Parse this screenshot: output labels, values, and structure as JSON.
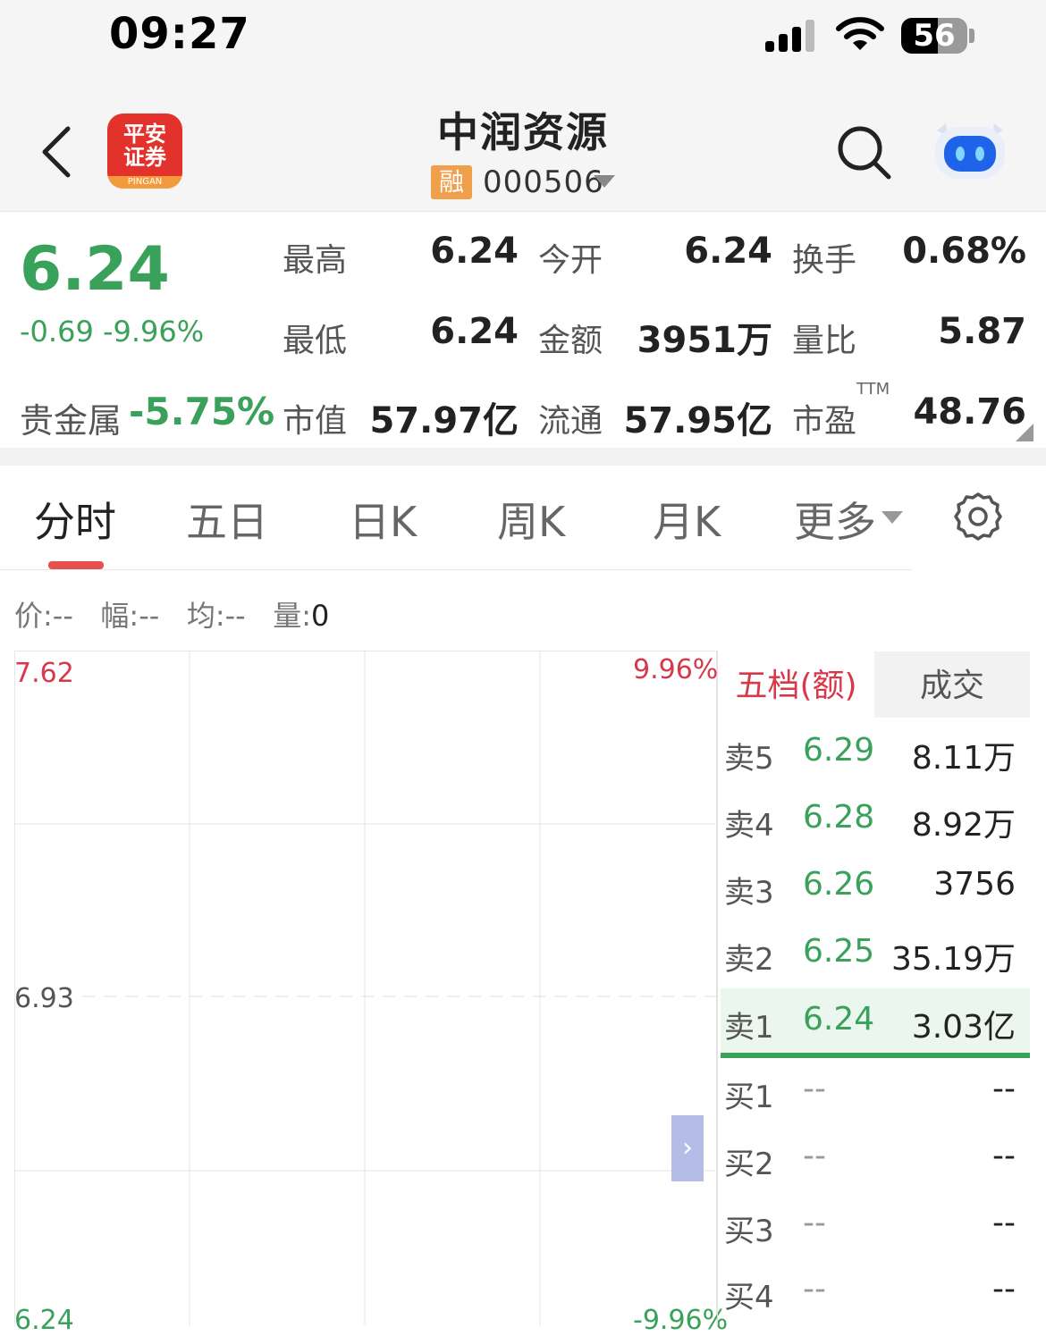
{
  "status_bar": {
    "time": "09:27",
    "battery": "56",
    "battery_level": 0.56
  },
  "header": {
    "back_icon": "chevron-left-icon",
    "logo_line1": "平安",
    "logo_line2": "证券",
    "logo_small": "PINGAN",
    "stock_name": "中润资源",
    "margin_badge": "融",
    "stock_code": "000506",
    "search_icon": "search-icon",
    "assistant_icon": "robot-icon"
  },
  "quote": {
    "price": "6.24",
    "change": "-0.69 -9.96%",
    "sector_label": "贵金属",
    "sector_change": "-5.75%",
    "stats": [
      {
        "label": "最高",
        "value": "6.24",
        "green": true
      },
      {
        "label": "今开",
        "value": "6.24",
        "green": true
      },
      {
        "label": "换手",
        "value": "0.68%",
        "green": false
      },
      {
        "label": "最低",
        "value": "6.24",
        "green": true
      },
      {
        "label": "金额",
        "value": "3951万",
        "green": false
      },
      {
        "label": "量比",
        "value": "5.87",
        "green": false
      },
      {
        "label": "市值",
        "value": "57.97亿",
        "green": false
      },
      {
        "label": "流通",
        "value": "57.95亿",
        "green": false
      },
      {
        "label": "市盈",
        "value": "48.76",
        "green": false
      }
    ],
    "ttm": "TTM"
  },
  "tabs": {
    "items": [
      "分时",
      "五日",
      "日K",
      "周K",
      "月K",
      "更多"
    ],
    "active": 0,
    "settings_icon": "gear-icon"
  },
  "info_line": {
    "price_label": "价:",
    "price_value": "--",
    "amp_label": "幅:",
    "amp_value": "--",
    "avg_label": "均:",
    "avg_value": "--",
    "vol_label": "量:",
    "vol_value": "0"
  },
  "chart": {
    "y_high": "7.62",
    "y_mid": "6.93",
    "y_low": "6.24",
    "pct_high": "9.96%",
    "pct_low": "-9.96%",
    "expand_icon": "›"
  },
  "order_book": {
    "tab_depth": "五档(额)",
    "tab_trades": "成交",
    "sells": [
      {
        "label": "卖5",
        "price": "6.29",
        "volume": "8.11万"
      },
      {
        "label": "卖4",
        "price": "6.28",
        "volume": "8.92万"
      },
      {
        "label": "卖3",
        "price": "6.26",
        "volume": "3756"
      },
      {
        "label": "卖2",
        "price": "6.25",
        "volume": "35.19万"
      },
      {
        "label": "卖1",
        "price": "6.24",
        "volume": "3.03亿"
      }
    ],
    "buys": [
      {
        "label": "买1",
        "price": "--",
        "volume": "--"
      },
      {
        "label": "买2",
        "price": "--",
        "volume": "--"
      },
      {
        "label": "买3",
        "price": "--",
        "volume": "--"
      },
      {
        "label": "买4",
        "price": "--",
        "volume": "--"
      }
    ]
  },
  "colors": {
    "down": "#3aa15a",
    "up": "#d7384a",
    "brand": "#e2322b"
  }
}
